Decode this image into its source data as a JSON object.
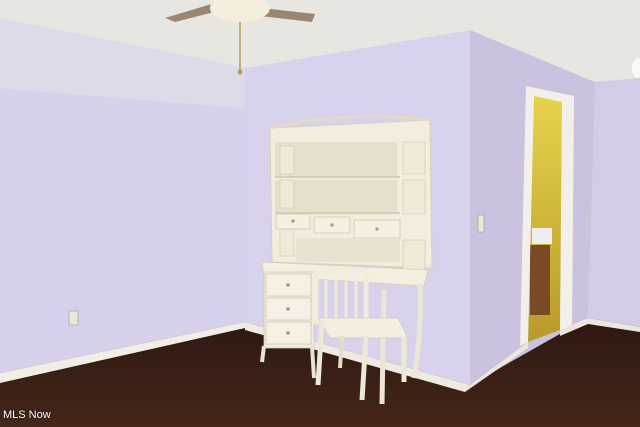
{
  "watermark": {
    "text": "MLS Now"
  },
  "colors": {
    "wall_left": "#d9d2ec",
    "wall_back": "#d7d0ea",
    "wall_right": "#cfc6e2",
    "ceiling": "#e7e5e0",
    "floor": "#3a2018",
    "trim": "#f3f0ea",
    "furniture": "#f1ecdc",
    "bathroom": "#d9c23a"
  }
}
